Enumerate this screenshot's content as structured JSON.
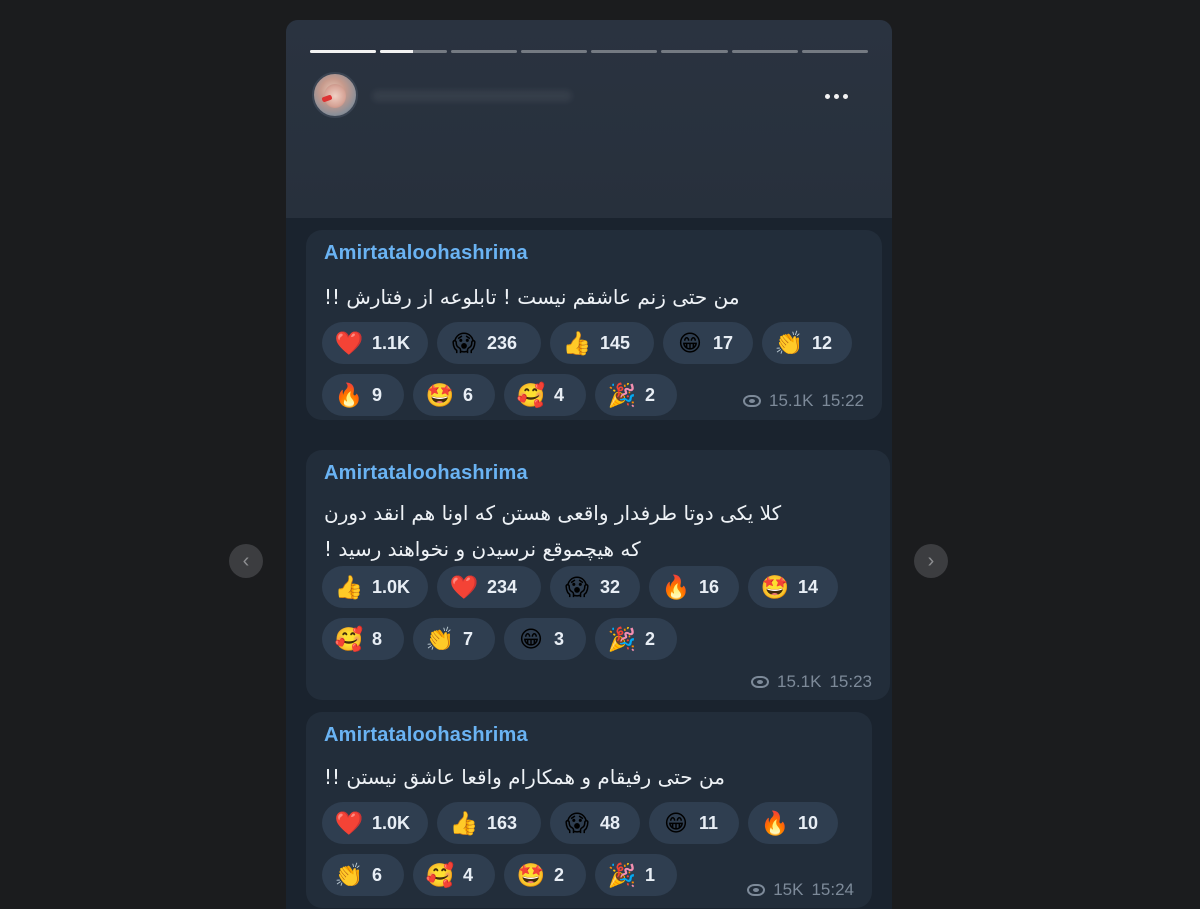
{
  "story": {
    "progress": [
      1,
      0.5,
      0,
      0,
      0,
      0,
      0,
      0
    ],
    "more_icon": "more-horizontal-icon"
  },
  "messages": [
    {
      "sender": "Amirtataloohashrima",
      "text": "من حتی زنم عاشقم نیست ! تابلوعه از رفتارش !!",
      "reactions": [
        {
          "emoji": "❤️",
          "icon": "heart",
          "count": "1.1K"
        },
        {
          "emoji": "😱",
          "icon": "scream",
          "count": "236"
        },
        {
          "emoji": "👍",
          "icon": "thumbs-up",
          "count": "145"
        },
        {
          "emoji": "😁",
          "icon": "grin",
          "count": "17"
        },
        {
          "emoji": "👏",
          "icon": "clap",
          "count": "12"
        },
        {
          "emoji": "🔥",
          "icon": "fire",
          "count": "9"
        },
        {
          "emoji": "🤩",
          "icon": "star-struck",
          "count": "6"
        },
        {
          "emoji": "🥰",
          "icon": "smiling-hearts",
          "count": "4"
        },
        {
          "emoji": "🎉",
          "icon": "party-popper",
          "count": "2"
        }
      ],
      "views": "15.1K",
      "time": "15:22"
    },
    {
      "sender": "Amirtataloohashrima",
      "text_lines": [
        "کلا یکی دوتا طرفدار واقعی هستن که اونا هم انقد دورن",
        "که هیچموقع نرسیدن و نخواهند رسید !"
      ],
      "reactions": [
        {
          "emoji": "👍",
          "icon": "thumbs-up",
          "count": "1.0K"
        },
        {
          "emoji": "❤️",
          "icon": "heart",
          "count": "234"
        },
        {
          "emoji": "😱",
          "icon": "scream",
          "count": "32"
        },
        {
          "emoji": "🔥",
          "icon": "fire",
          "count": "16"
        },
        {
          "emoji": "🤩",
          "icon": "star-struck",
          "count": "14"
        },
        {
          "emoji": "🥰",
          "icon": "smiling-hearts",
          "count": "8"
        },
        {
          "emoji": "👏",
          "icon": "clap",
          "count": "7"
        },
        {
          "emoji": "😁",
          "icon": "grin",
          "count": "3"
        },
        {
          "emoji": "🎉",
          "icon": "party-popper",
          "count": "2"
        }
      ],
      "views": "15.1K",
      "time": "15:23"
    },
    {
      "sender": "Amirtataloohashrima",
      "text": "من حتی رفیقام و همکارام واقعا عاشق نیستن !!",
      "reactions": [
        {
          "emoji": "❤️",
          "icon": "heart",
          "count": "1.0K"
        },
        {
          "emoji": "👍",
          "icon": "thumbs-up",
          "count": "163"
        },
        {
          "emoji": "😱",
          "icon": "scream",
          "count": "48"
        },
        {
          "emoji": "😁",
          "icon": "grin",
          "count": "11"
        },
        {
          "emoji": "🔥",
          "icon": "fire",
          "count": "10"
        },
        {
          "emoji": "👏",
          "icon": "clap",
          "count": "6"
        },
        {
          "emoji": "🥰",
          "icon": "smiling-hearts",
          "count": "4"
        },
        {
          "emoji": "🤩",
          "icon": "star-struck",
          "count": "2"
        },
        {
          "emoji": "🎉",
          "icon": "party-popper",
          "count": "1"
        }
      ],
      "views": "15K",
      "time": "15:24"
    }
  ],
  "nav": {
    "prev_glyph": "‹",
    "next_glyph": "›"
  }
}
